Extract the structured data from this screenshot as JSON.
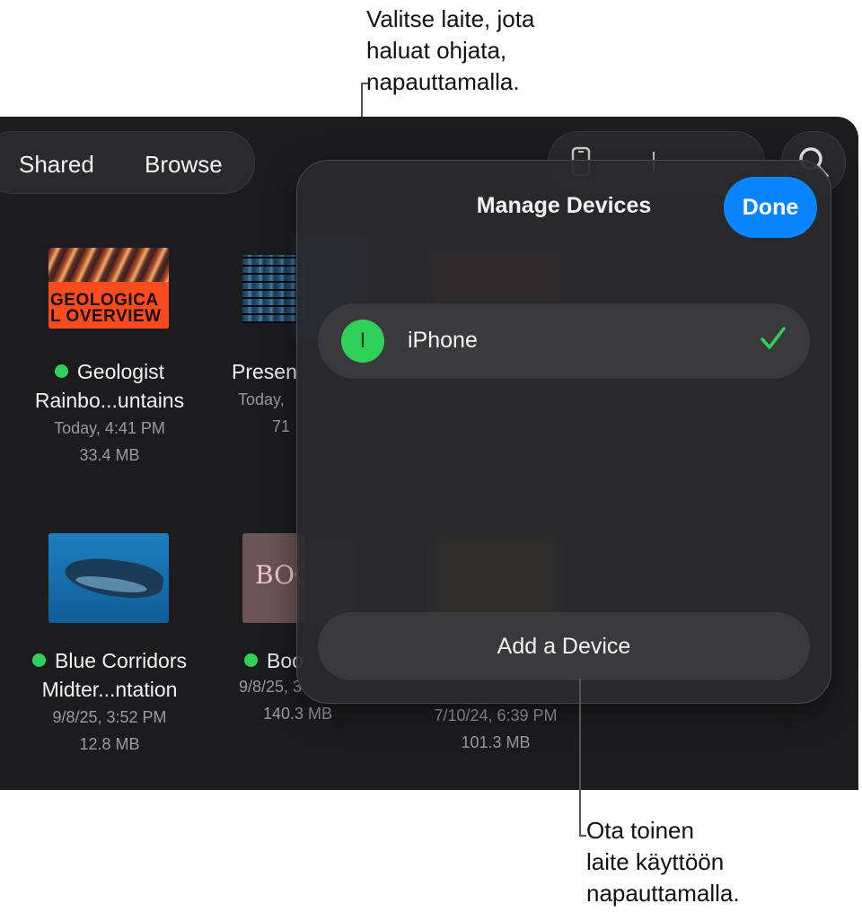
{
  "callouts": {
    "top": "Valitse laite, jota\nhaluat ohjata,\nnapauttamalla.",
    "bottom": "Ota toinen\nlaite käyttöön\nnapauttamalla."
  },
  "toolbar": {
    "tabs": [
      "Shared",
      "Browse"
    ]
  },
  "documents": [
    {
      "title_line1": "Geologist",
      "title_line2": "Rainbo...untains",
      "date": "Today, 4:41 PM",
      "size": "33.4 MB",
      "synced": true,
      "thumb_text": "GEOLOGICA\nL OVERVIEW"
    },
    {
      "title_line1": "Presen",
      "date": "Today,",
      "size": "71"
    },
    {
      "title_line1": "Blue Corridors",
      "title_line2": "Midter...ntation",
      "date": "9/8/25, 3:52 PM",
      "size": "12.8 MB",
      "synced": true
    },
    {
      "title_line1": "Boo",
      "date": "9/8/25, 3",
      "size": "140.3 MB",
      "synced": true,
      "thumb_text": "BOO"
    },
    {
      "date": "7/10/24, 6:39 PM",
      "size": "101.3 MB"
    }
  ],
  "popover": {
    "title": "Manage Devices",
    "done_label": "Done",
    "device": {
      "name": "iPhone",
      "initial": "I",
      "selected": true
    },
    "add_label": "Add a Device"
  },
  "colors": {
    "accent": "#0a84ff",
    "sync_dot": "#30d158",
    "background": "#1c1c1e"
  },
  "icons": [
    "phone-icon",
    "search-icon",
    "checkmark-icon"
  ]
}
